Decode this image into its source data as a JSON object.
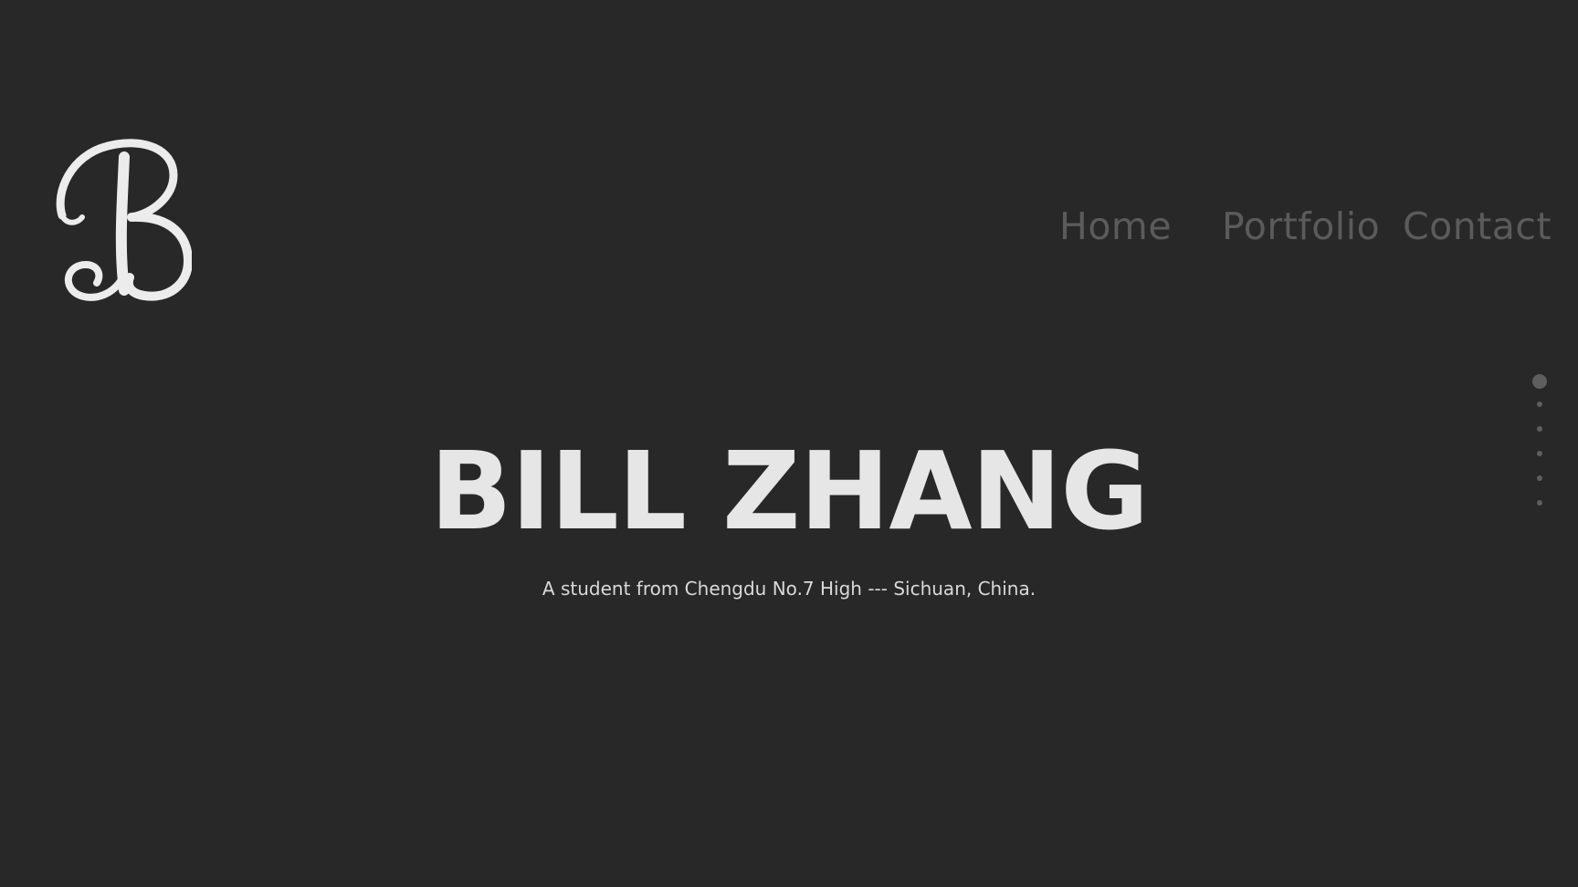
{
  "logo": {
    "letter": "B",
    "color": "#ececec",
    "alt": "B monogram logo"
  },
  "nav": {
    "items": [
      {
        "label": "Home"
      },
      {
        "label": "Portfolio"
      },
      {
        "label": "Contact"
      }
    ],
    "color": "#5b5b5b"
  },
  "hero": {
    "title": "BILL ZHANG",
    "subtitle": "A student from Chengdu No.7 High --- Sichuan, China.",
    "title_color": "#e6e6e6"
  },
  "section_nav": {
    "count": 6,
    "active_index": 0,
    "color": "#5e5e5e"
  },
  "theme": {
    "background": "#282828"
  }
}
